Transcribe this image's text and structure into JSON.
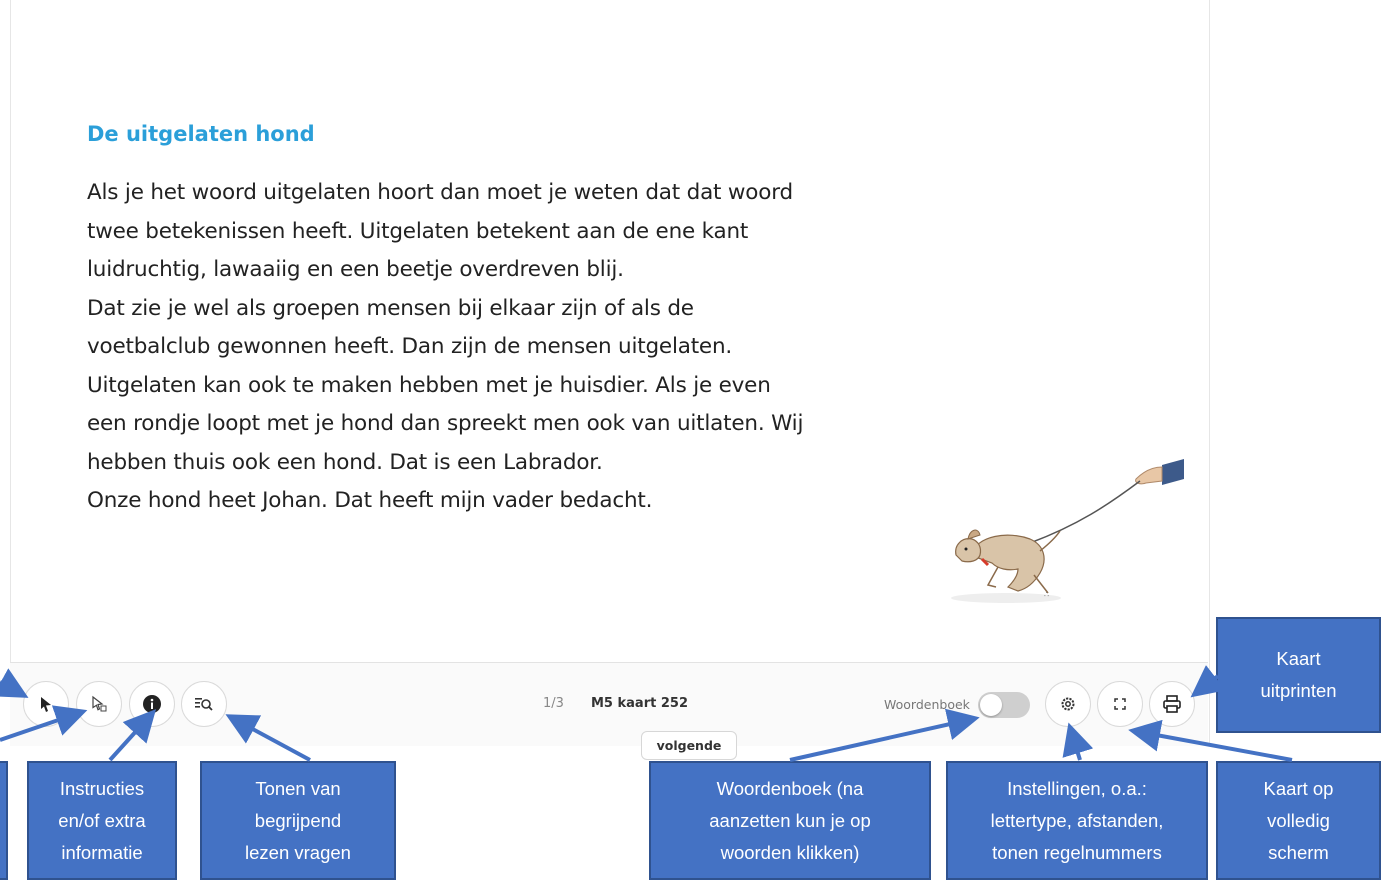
{
  "article": {
    "title": "De uitgelaten hond",
    "lines": [
      "Als je het woord uitgelaten hoort dan moet je weten dat dat woord",
      "twee betekenissen heeft. Uitgelaten betekent aan de ene kant",
      "luidruchtig, lawaaiig en een beetje overdreven blij.",
      "Dat zie je wel als groepen mensen bij elkaar zijn of als de",
      "voetbalclub gewonnen heeft. Dan zijn de mensen uitgelaten.",
      "Uitgelaten kan ook te maken hebben met je huisdier. Als je even",
      "een rondje loopt met je hond dan spreekt men ook van uitlaten. Wij",
      "hebben thuis ook een hond. Dat is een Labrador.",
      "Onze hond heet Johan. Dat heeft mijn vader bedacht."
    ]
  },
  "toolbar": {
    "pager": "1/3",
    "card_name": "M5 kaart 252",
    "dictionary_label": "Woordenboek",
    "dictionary_on": false,
    "next_label": "volgende",
    "icons": [
      "pointer-icon",
      "select-read-icon",
      "info-icon",
      "reading-questions-icon",
      "gear-icon",
      "fullscreen-icon",
      "printer-icon"
    ]
  },
  "callouts": {
    "print": [
      "Kaart",
      "uitprinten"
    ],
    "instructions": [
      "Instructies",
      "en/of extra",
      "informatie"
    ],
    "questions": [
      "Tonen van",
      "begrijpend",
      "lezen vragen"
    ],
    "dictionary": [
      "Woordenboek (na",
      "aanzetten kun je op",
      "woorden klikken)"
    ],
    "settings": [
      "Instellingen, o.a.:",
      "lettertype, afstanden,",
      "tonen regelnummers"
    ],
    "fullscreen": [
      "Kaart op",
      "volledig",
      "scherm"
    ]
  },
  "colors": {
    "title": "#2b9fd9",
    "callout_fill": "#4472c4",
    "callout_border": "#2f528f"
  }
}
